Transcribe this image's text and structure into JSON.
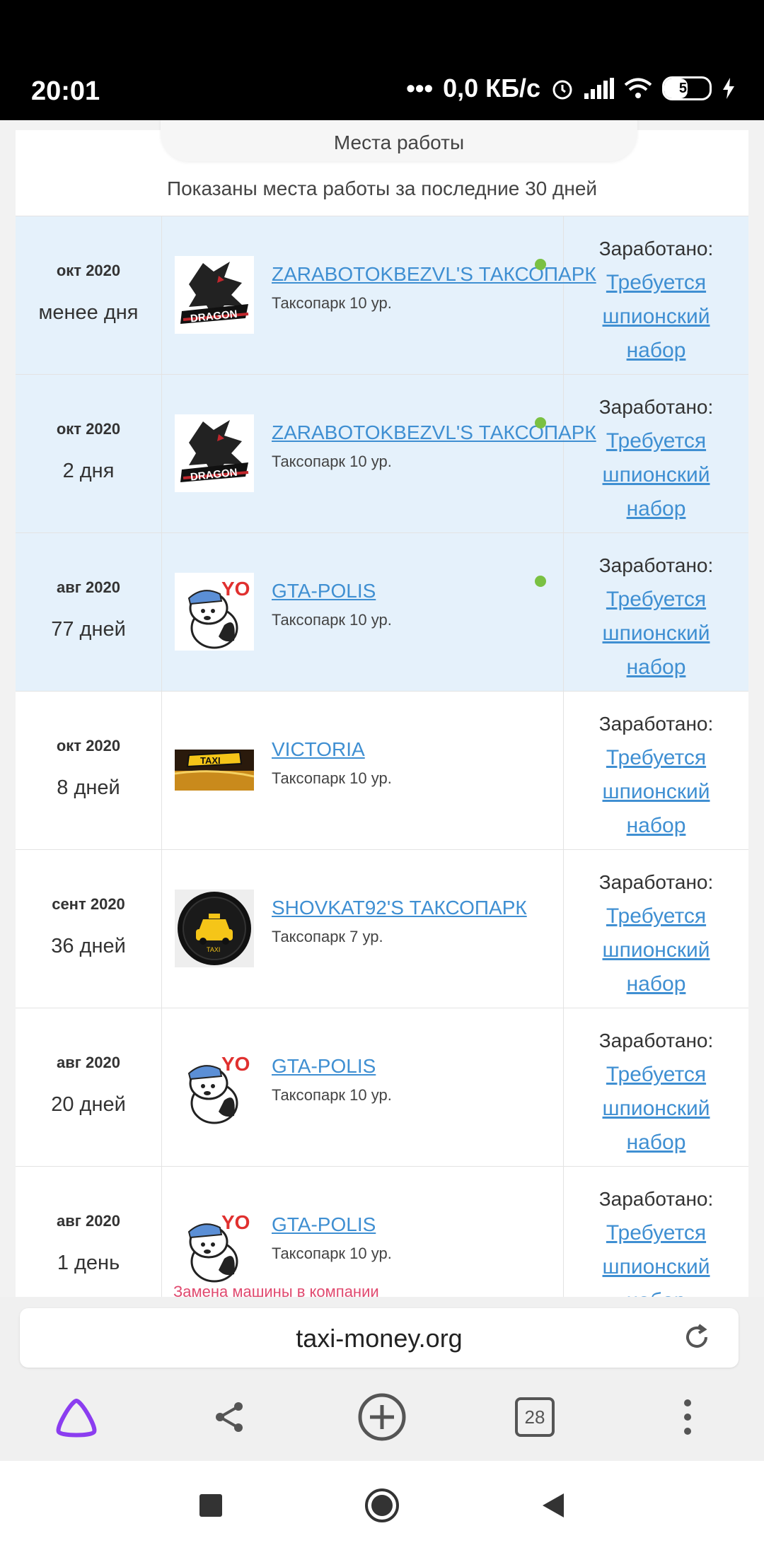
{
  "status": {
    "time": "20:01",
    "net": "0,0 КБ/с",
    "battery": "52",
    "battery_level": 0.52
  },
  "section": {
    "title": "Места работы",
    "subtitle": "Показаны места работы за последние 30 дней"
  },
  "rows": [
    {
      "date": "окт 2020",
      "duration": "менее дня",
      "name": "ZARABOTOKBEZVL'S ТАКСОПАРК",
      "level": "Таксопарк 10 ур.",
      "earn_label": "Заработано:",
      "earn_link": [
        "Требуется",
        "шпионский",
        "набор"
      ],
      "logo": "dragon",
      "online": true,
      "highlight": true,
      "note": ""
    },
    {
      "date": "окт 2020",
      "duration": "2 дня",
      "name": "ZARABOTOKBEZVL'S ТАКСОПАРК",
      "level": "Таксопарк 10 ур.",
      "earn_label": "Заработано:",
      "earn_link": [
        "Требуется",
        "шпионский",
        "набор"
      ],
      "logo": "dragon",
      "online": true,
      "highlight": true,
      "note": ""
    },
    {
      "date": "авг 2020",
      "duration": "77 дней",
      "name": "GTA-POLIS",
      "level": "Таксопарк 10 ур.",
      "earn_label": "Заработано:",
      "earn_link": [
        "Требуется",
        "шпионский",
        "набор"
      ],
      "logo": "bear",
      "online": true,
      "highlight": true,
      "note": ""
    },
    {
      "date": "окт 2020",
      "duration": "8 дней",
      "name": "VICTORIA",
      "level": "Таксопарк 10 ур.",
      "earn_label": "Заработано:",
      "earn_link": [
        "Требуется",
        "шпионский",
        "набор"
      ],
      "logo": "taxi-sign",
      "online": false,
      "highlight": false,
      "note": ""
    },
    {
      "date": "сент 2020",
      "duration": "36 дней",
      "name": "SHOVKAT92'S ТАКСОПАРК",
      "level": "Таксопарк 7 ур.",
      "earn_label": "Заработано:",
      "earn_link": [
        "Требуется",
        "шпионский",
        "набор"
      ],
      "logo": "taxi-badge",
      "online": false,
      "highlight": false,
      "note": ""
    },
    {
      "date": "авг 2020",
      "duration": "20 дней",
      "name": "GTA-POLIS",
      "level": "Таксопарк 10 ур.",
      "earn_label": "Заработано:",
      "earn_link": [
        "Требуется",
        "шпионский",
        "набор"
      ],
      "logo": "bear",
      "online": false,
      "highlight": false,
      "note": ""
    },
    {
      "date": "авг 2020",
      "duration": "1 день",
      "name": "GTA-POLIS",
      "level": "Таксопарк 10 ур.",
      "earn_label": "Заработано:",
      "earn_link": [
        "Требуется",
        "шпионский",
        "набор"
      ],
      "logo": "bear",
      "online": false,
      "highlight": false,
      "note": "Замена машины в компании"
    }
  ],
  "browser": {
    "url": "taxi-money.org",
    "tabs_count": "28"
  },
  "colors": {
    "link": "#3f8fd2",
    "highlight_row": "#e5f1fb",
    "online_dot": "#7ac142",
    "note": "#e04a6f",
    "alice": "#8b3df0"
  }
}
